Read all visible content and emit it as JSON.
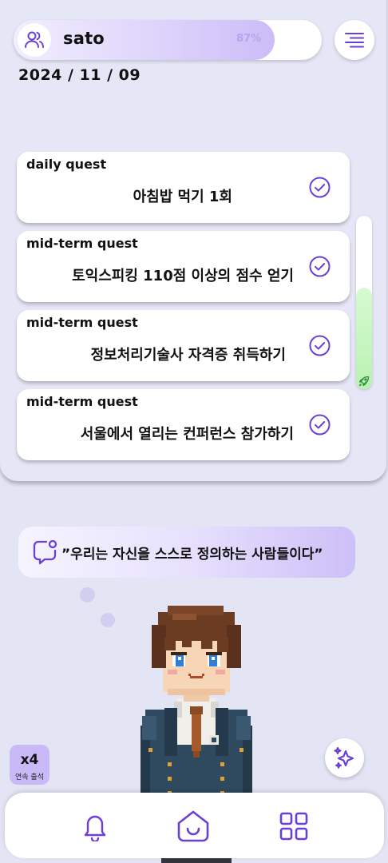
{
  "header": {
    "username": "sato",
    "progress_text": "87%",
    "progress_value": 0.87,
    "date": "2024 / 11 / 09"
  },
  "quests": [
    {
      "type": "daily quest",
      "title": "아침밥 먹기 1회",
      "completed": true
    },
    {
      "type": "mid-term quest",
      "title": "토익스피킹 110점 이상의 점수 얻기",
      "completed": true
    },
    {
      "type": "mid-term quest",
      "title": "정보처리기술사 자격증 취득하기",
      "completed": true
    },
    {
      "type": "mid-term quest",
      "title": "서울에서 열리는 컨퍼런스 참가하기",
      "completed": true
    }
  ],
  "scrollbar": {
    "icon": "rocket-icon",
    "position": 0.55
  },
  "quote": {
    "text": "”우리는 자신을 스스로 정의하는 사람들이다”",
    "icon": "message-notification-icon"
  },
  "streak": {
    "count": "x4",
    "label": "연속 출석"
  },
  "nav": {
    "items": [
      "bell-icon",
      "home-icon",
      "grid-icon"
    ]
  },
  "colors": {
    "accent": "#6c3fd6",
    "background": "#e3e4f4",
    "progress_fill": "#cdbcf8",
    "scroll_thumb": "#b9f2b0"
  }
}
